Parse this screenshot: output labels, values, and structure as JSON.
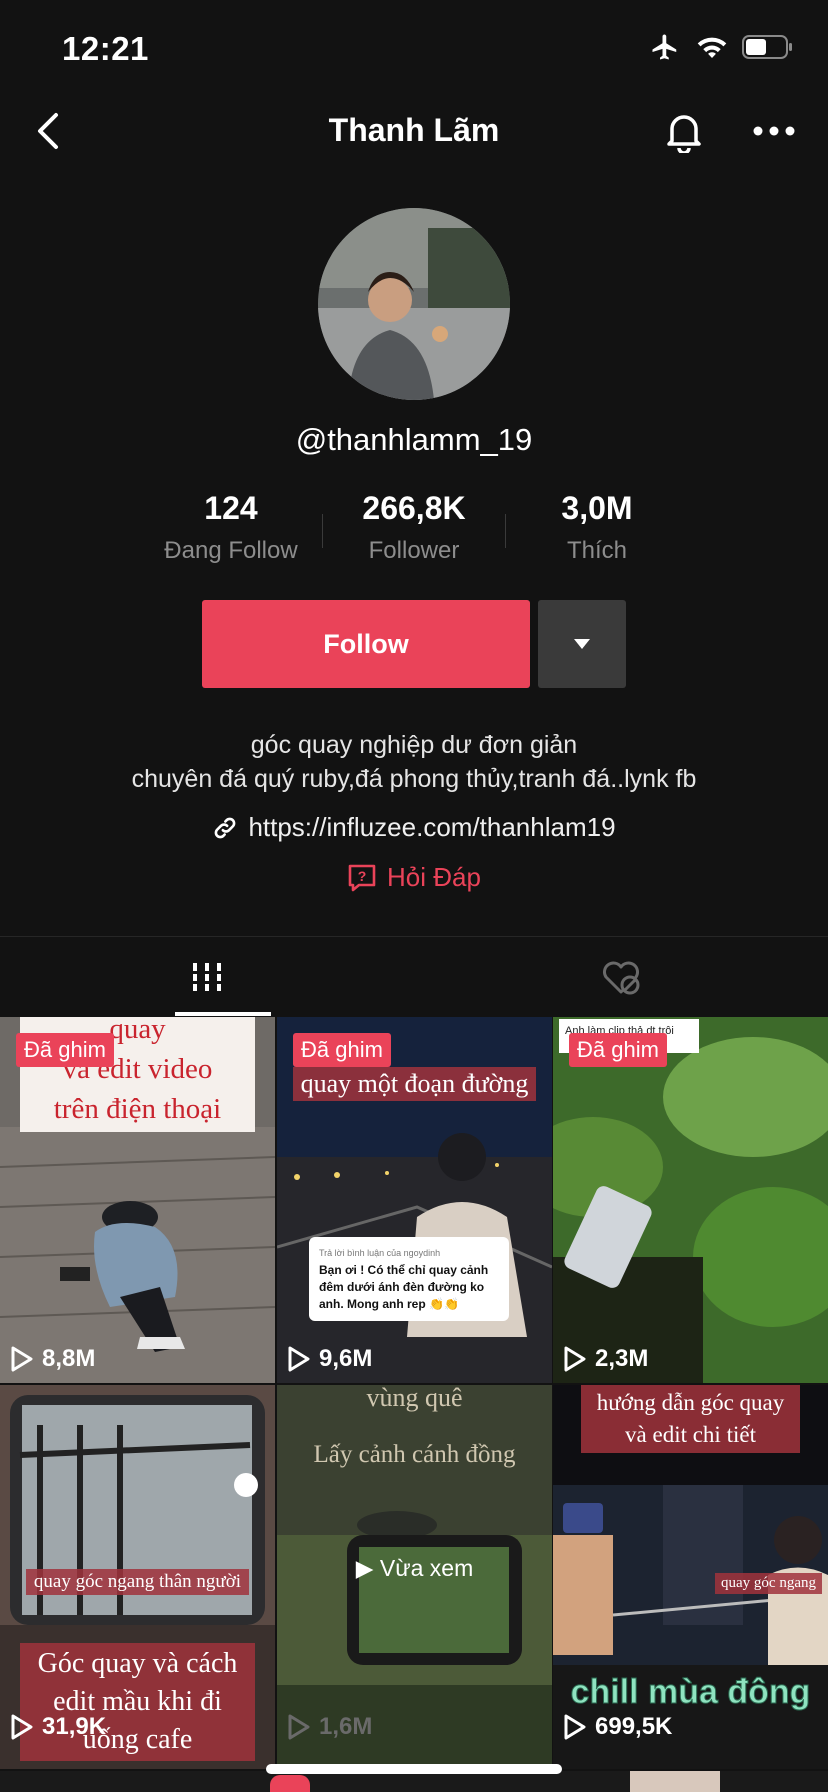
{
  "status": {
    "time": "12:21"
  },
  "nav": {
    "title": "Thanh Lãm"
  },
  "profile": {
    "username": "@thanhlamm_19",
    "stats": [
      {
        "value": "124",
        "label": "Đang Follow"
      },
      {
        "value": "266,8K",
        "label": "Follower"
      },
      {
        "value": "3,0M",
        "label": "Thích"
      }
    ],
    "follow_label": "Follow",
    "bio_line1": "góc quay nghiệp dư đơn giản",
    "bio_line2": "chuyên đá quý ruby,đá phong thủy,tranh đá..lynk fb",
    "link": "https://influzee.com/thanhlam19",
    "qa_label": "Hỏi Đáp"
  },
  "colors": {
    "accent": "#ea4359",
    "background": "#121212"
  },
  "videos": [
    {
      "views": "8,8M",
      "pinned": "Đã ghim",
      "caption": "quay\nvà edit video\ntrên điện thoại"
    },
    {
      "views": "9,6M",
      "pinned": "Đã ghim",
      "caption": "quay một đoạn đường",
      "comment_header": "Trả lời bình luận của ngoydinh",
      "comment": "Bạn ơi ! Có thể chỉ quay cảnh đêm dưới ánh đèn đường ko anh. Mong anh rep 👏👏"
    },
    {
      "views": "2,3M",
      "pinned": "Đã ghim",
      "caption": "Anh làm clip thả dt trôi"
    },
    {
      "views": "31,9K",
      "caption1": "quay góc ngang thân người",
      "caption2": "Góc quay và cách edit mầu khi đi uống cafe"
    },
    {
      "views": "1,6M",
      "caption1": "vùng quê",
      "caption2": "Lấy cảnh cánh đồng",
      "watched": "Vừa xem"
    },
    {
      "views": "699,5K",
      "caption1": "hướng dẫn góc quay và edit chi tiết",
      "caption2": "quay góc ngang",
      "caption3": "chill mùa đông"
    }
  ]
}
